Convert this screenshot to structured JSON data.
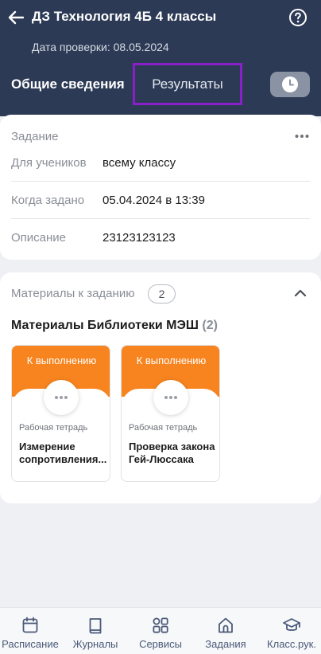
{
  "header": {
    "title": "ДЗ Технология 4Б 4 классы",
    "check_date": "Дата проверки: 08.05.2024"
  },
  "tabs": [
    {
      "label": "Общие сведения",
      "active": true
    },
    {
      "label": "Результаты",
      "active": false
    }
  ],
  "task": {
    "section_label": "Задание",
    "rows": [
      {
        "label": "Для учеников",
        "value": "всему классу"
      },
      {
        "label": "Когда задано",
        "value": "05.04.2024 в 13:39"
      },
      {
        "label": "Описание",
        "value": "23123123123"
      }
    ]
  },
  "materials": {
    "section_label": "Материалы к заданию",
    "count": "2",
    "library_title": "Материалы Библиотеки МЭШ",
    "library_count": "(2)",
    "items": [
      {
        "status": "К выполнению",
        "type": "Рабочая тетрадь",
        "name": "Измерение сопротивления..."
      },
      {
        "status": "К выполнению",
        "type": "Рабочая тетрадь",
        "name": "Проверка закона Гей-Люссака"
      }
    ]
  },
  "bottom_nav": [
    {
      "label": "Расписание",
      "icon": "calendar-icon"
    },
    {
      "label": "Журналы",
      "icon": "book-icon"
    },
    {
      "label": "Сервисы",
      "icon": "grid-icon"
    },
    {
      "label": "Задания",
      "icon": "house-icon"
    },
    {
      "label": "Класс.рук.",
      "icon": "graduation-cap-icon"
    }
  ],
  "colors": {
    "header_bg": "#2c3a55",
    "accent_orange": "#f7841f",
    "highlight_purple": "#8a1fc9",
    "nav_text": "#4a5a78"
  }
}
